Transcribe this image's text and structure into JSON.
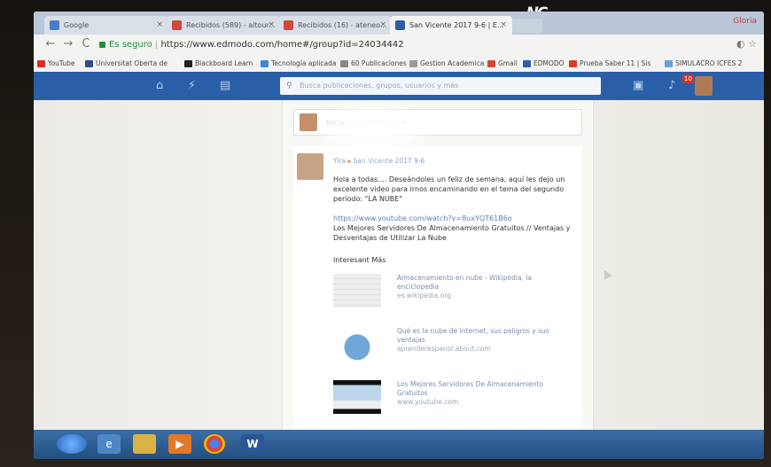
{
  "monitor": {
    "brand_logo": "NC"
  },
  "tabs": [
    {
      "label": "Google",
      "favicon_color": "#4a7bd0"
    },
    {
      "label": "Recibidos (589) - altour...",
      "favicon_color": "#d44638"
    },
    {
      "label": "Recibidos (16) - ateneo...",
      "favicon_color": "#d44638"
    },
    {
      "label": "San Vicente 2017 9-6 | E...",
      "favicon_color": "#2a5fa8"
    }
  ],
  "tab_close_glyph": "×",
  "profile_name": "Gloria",
  "toolbar": {
    "back": "←",
    "forward": "→",
    "reload": "C",
    "secure_label": "Es seguro",
    "url": "https://www.edmodo.com/home#/group?id=24034442",
    "right_icons": "◐ ☆"
  },
  "bookmarks": [
    {
      "label": "YouTube",
      "color": "#e02b27"
    },
    {
      "label": "Universitat Oberta de",
      "color": "#2a4f8f"
    },
    {
      "label": "Blackboard Learn",
      "color": "#222222"
    },
    {
      "label": "Tecnología aplicada",
      "color": "#3b8ad9"
    },
    {
      "label": "60 Publicaciones",
      "color": "#888888"
    },
    {
      "label": "Gestion Academica",
      "color": "#999999"
    },
    {
      "label": "Gmail",
      "color": "#d44638"
    },
    {
      "label": "EDMODO",
      "color": "#2a5fa8"
    },
    {
      "label": "Prueba Saber 11 | Sis",
      "color": "#d83a2a"
    },
    {
      "label": "SIMULACRO ICFES 2",
      "color": "#6aa0d8"
    }
  ],
  "edmodo_nav": {
    "search_placeholder": "Busca publicaciones, grupos, usuarios y más",
    "notification_count": "10"
  },
  "composer": {
    "placeholder": "Iniciar una publicación"
  },
  "post": {
    "author": "Yira",
    "group": "San Vicente 2017 9-6",
    "text": "Hola a todas.... Deseándoles un feliz de semana, aquí les dejo un excelente video para irnos encaminando en el tema del segundo periodo: \"LA NUBE\"",
    "link_url": "https://www.youtube.com/watch?v=8uxYQT61B6o",
    "link_title": "Los Mejores Servidores De Almacenamiento Gratuitos // Ventajas y Desventajas de Utilizar La Nube",
    "links_heading": "Interesant Más",
    "link_cards": [
      {
        "title": "Almacenamiento en nube - Wikipedia, la enciclopedia",
        "url": "es.wikipedia.org"
      },
      {
        "title": "Qué es la nube de Internet, sus peligros y sus ventajas",
        "url": "aprenderespanol.about.com"
      },
      {
        "title": "Los Mejores Servidores De Almacenamiento Gratuitos",
        "url": "www.youtube.com"
      }
    ]
  },
  "taskbar": {
    "word_label": "W"
  }
}
